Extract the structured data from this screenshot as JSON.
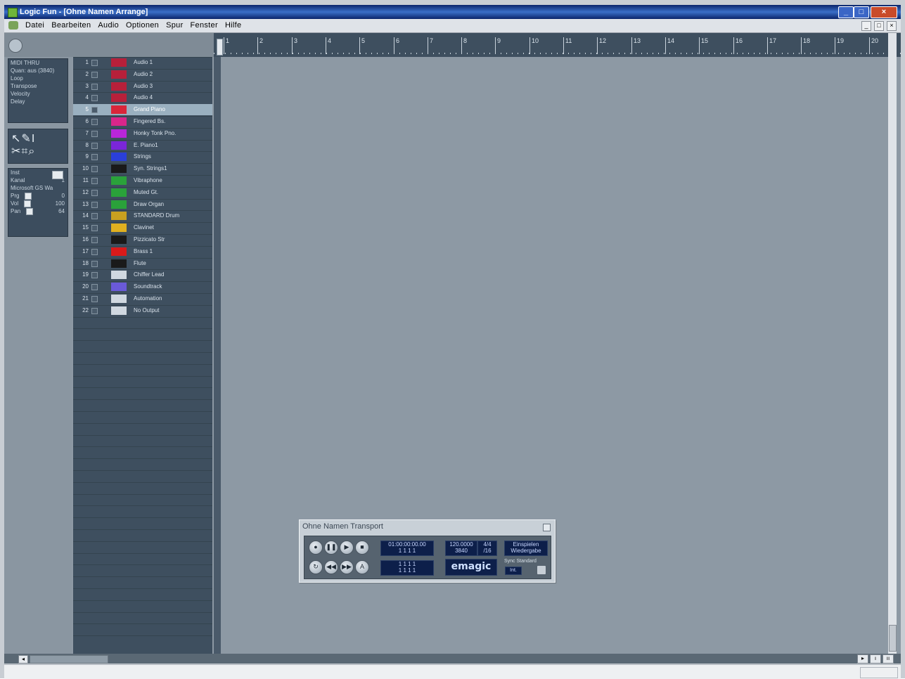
{
  "window": {
    "title": "Logic Fun - [Ohne Namen Arrange]"
  },
  "menu": {
    "items": [
      "Datei",
      "Bearbeiten",
      "Audio",
      "Optionen",
      "Spur",
      "Fenster",
      "Hilfe"
    ]
  },
  "inspector": {
    "region": [
      "MIDI THRU",
      "Quan: aus (3840)",
      "Loop",
      "Transpose",
      "Velocity",
      "Delay"
    ],
    "instrument": {
      "rows": [
        {
          "label": "Inst",
          "value": ""
        },
        {
          "label": "Kanal",
          "value": "1"
        },
        {
          "label": "Microsoft GS Wa",
          "value": ""
        },
        {
          "label": "Prg",
          "value": "0"
        },
        {
          "label": "Vol",
          "value": "100"
        },
        {
          "label": "Pan",
          "value": "64"
        }
      ]
    }
  },
  "ruler": {
    "bars": [
      "1",
      "2",
      "3",
      "4",
      "5",
      "6",
      "7",
      "8",
      "9",
      "10",
      "11",
      "12",
      "13",
      "14",
      "15",
      "16",
      "17",
      "18",
      "19",
      "20"
    ]
  },
  "tracks": [
    {
      "num": "1",
      "name": "Audio 1",
      "icon_color": "#b7203a",
      "icon": "audio-icon"
    },
    {
      "num": "2",
      "name": "Audio 2",
      "icon_color": "#b7203a",
      "icon": "audio-icon"
    },
    {
      "num": "3",
      "name": "Audio 3",
      "icon_color": "#b7203a",
      "icon": "audio-icon"
    },
    {
      "num": "4",
      "name": "Audio 4",
      "icon_color": "#b7203a",
      "icon": "audio-icon"
    },
    {
      "num": "5",
      "name": "Grand Piano",
      "icon_color": "#d9263a",
      "icon": "grand-piano-icon",
      "selected": true
    },
    {
      "num": "6",
      "name": "Fingered Bs.",
      "icon_color": "#d9268a",
      "icon": "bass-icon"
    },
    {
      "num": "7",
      "name": "Honky Tonk Pno.",
      "icon_color": "#b926d9",
      "icon": "honky-tonk-icon"
    },
    {
      "num": "8",
      "name": "E. Piano1",
      "icon_color": "#7a26d9",
      "icon": "epiano-icon"
    },
    {
      "num": "9",
      "name": "Strings",
      "icon_color": "#2a3fd9",
      "icon": "strings-icon"
    },
    {
      "num": "10",
      "name": "Syn. Strings1",
      "icon_color": "#1a1a1a",
      "icon": "synth-strings-icon"
    },
    {
      "num": "11",
      "name": "Vibraphone",
      "icon_color": "#2aa23a",
      "icon": "vibraphone-icon"
    },
    {
      "num": "12",
      "name": "Muted Gt.",
      "icon_color": "#2aa23a",
      "icon": "guitar-icon"
    },
    {
      "num": "13",
      "name": "Draw Organ",
      "icon_color": "#2aa23a",
      "icon": "organ-icon"
    },
    {
      "num": "14",
      "name": "STANDARD Drum",
      "icon_color": "#c8a020",
      "icon": "drum-icon"
    },
    {
      "num": "15",
      "name": "Clavinet",
      "icon_color": "#e0b020",
      "icon": "clavinet-icon"
    },
    {
      "num": "16",
      "name": "Pizzicato Str",
      "icon_color": "#1a1a1a",
      "icon": "pizzicato-icon"
    },
    {
      "num": "17",
      "name": "Brass 1",
      "icon_color": "#d91a1a",
      "icon": "brass-icon"
    },
    {
      "num": "18",
      "name": "Flute",
      "icon_color": "#1a1a1a",
      "icon": "flute-icon"
    },
    {
      "num": "19",
      "name": "Chiffer Lead",
      "icon_color": "#d0d8e0",
      "icon": "lead-icon"
    },
    {
      "num": "20",
      "name": "Soundtrack",
      "icon_color": "#6a5ad9",
      "icon": "soundtrack-icon"
    },
    {
      "num": "21",
      "name": "Automation",
      "icon_color": "#d0d8e0",
      "icon": "automation-icon"
    },
    {
      "num": "22",
      "name": "No Output",
      "icon_color": "#d0d8e0",
      "icon": "no-output-icon"
    }
  ],
  "transport": {
    "title": "Ohne Namen Transport",
    "smpte": "01:00:00:00.00",
    "position": "1 1 1 1",
    "locator": "1 1 1 1",
    "tempo": "120.0000",
    "ppq": "3840",
    "signature": "4/4",
    "division": "/16",
    "mode": "Einspielen",
    "mode2": "Wiedergabe",
    "sync_label": "Sync Standard",
    "sync_btn": "Int.",
    "logo": "emagic"
  }
}
